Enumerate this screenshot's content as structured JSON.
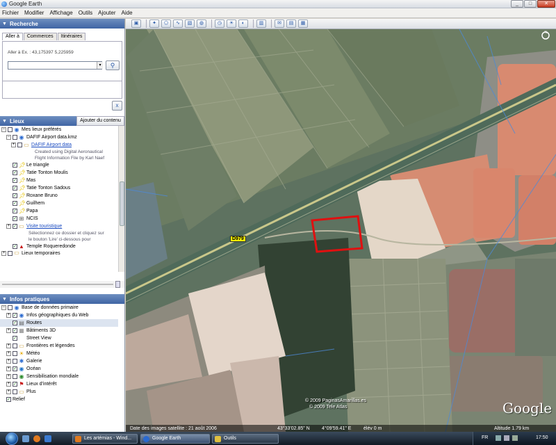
{
  "window": {
    "title": "Google Earth",
    "minimize": "_",
    "maximize": "□",
    "close": "✕"
  },
  "menu": [
    "Fichier",
    "Modifier",
    "Affichage",
    "Outils",
    "Ajouter",
    "Aide"
  ],
  "search": {
    "header": "Recherche",
    "tabs": [
      "Aller à",
      "Commerces",
      "Itinéraires"
    ],
    "hint": "Aller à Ex. : 43,175397 5,225959",
    "value": "",
    "go_icon": "magnifier-icon",
    "clear_label": "x"
  },
  "places": {
    "header": "Lieux",
    "add_content": "Ajouter du contenu",
    "items": [
      {
        "label": "Mes lieux préférés",
        "checked": false,
        "expanded": true
      },
      {
        "label": "DAFIF Airport data.kmz",
        "checked": false,
        "expanded": true
      },
      {
        "label": "DAFIF Airport data",
        "checked": false,
        "link": true
      },
      {
        "label": "Le triangle",
        "checked": true
      },
      {
        "label": "Tatie Tonton Moulis",
        "checked": true
      },
      {
        "label": "Mas",
        "checked": true
      },
      {
        "label": "Tatie Tonton Sadous",
        "checked": true
      },
      {
        "label": "Roxane Bruno",
        "checked": true
      },
      {
        "label": "Guilhem",
        "checked": true
      },
      {
        "label": "Papa",
        "checked": true
      },
      {
        "label": "NCIS",
        "checked": true
      },
      {
        "label": "Visite touristique",
        "checked": true,
        "link": true
      },
      {
        "label": "Temple Roqueredonde",
        "checked": true
      },
      {
        "label": "Lieux temporaires",
        "checked": false
      }
    ],
    "dafif_desc": [
      "Created using Digital Aeronautical",
      "Flight Information File by Karl Naef"
    ],
    "tour_desc": [
      "Sélectionnez ce dossier et cliquez sur",
      "le bouton 'Lire' ci-dessous pour"
    ]
  },
  "layers": {
    "header": "Infos pratiques",
    "items": [
      {
        "label": "Base de données primaire",
        "checked": false,
        "expanded": true
      },
      {
        "label": "Infos géographiques du Web",
        "checked": true
      },
      {
        "label": "Routes",
        "checked": true
      },
      {
        "label": "Bâtiments 3D",
        "checked": true
      },
      {
        "label": "Street View",
        "checked": true
      },
      {
        "label": "Frontières et légendes",
        "checked": false
      },
      {
        "label": "Météo",
        "checked": false
      },
      {
        "label": "Galerie",
        "checked": false
      },
      {
        "label": "Océan",
        "checked": true
      },
      {
        "label": "Sensibilisation mondiale",
        "checked": false
      },
      {
        "label": "Lieux d'intérêt",
        "checked": true
      },
      {
        "label": "Plus",
        "checked": false
      },
      {
        "label": "Relief",
        "checked": true
      }
    ]
  },
  "map": {
    "road_label": "D979",
    "credit1": "© 2009 PaginasAmarillas.es",
    "credit2": "© 2009 Tele Atlas",
    "logo": "Google",
    "status": {
      "date": "Date des images satellite : 21 août 2006",
      "lat": "43°33'02.85\" N",
      "lon": "4°09'59.41\" E",
      "elev": "élév    0 m",
      "altitude": "Altitude   1.79 km"
    },
    "highlight_color": "#e01010"
  },
  "taskbar": {
    "tasks": [
      "Les artémias - Wind...",
      "Google Earth",
      "Outils"
    ],
    "lang": "FR",
    "time": "17:50"
  }
}
